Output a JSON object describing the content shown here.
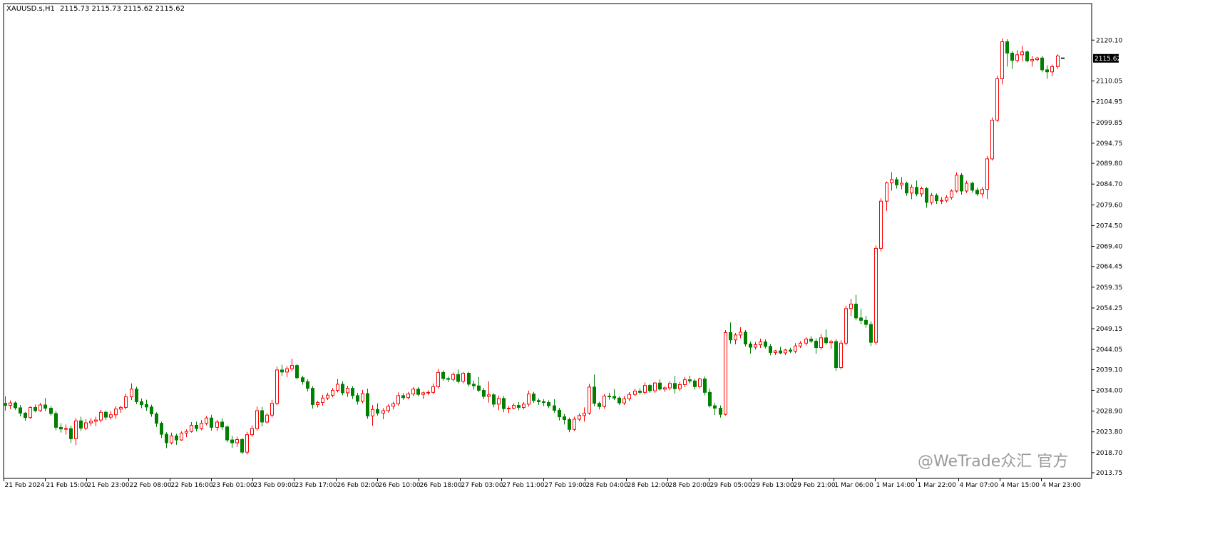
{
  "header": {
    "symbol": "XAUUSD.s,H1",
    "ohlc": "2115.73 2115.73 2115.62 2115.62"
  },
  "watermark": "@WeTrade众汇 官方",
  "colors": {
    "up": "#ff0000",
    "down": "#008000",
    "background": "#ffffff",
    "grid_frame": "#000000",
    "price_tag": "#000000"
  },
  "chart_data": {
    "type": "candlestick",
    "title": "",
    "symbol": "XAUUSD.s",
    "timeframe": "H1",
    "ylim": [
      2013.75,
      2124.0
    ],
    "y_ticks": [
      "2120.10",
      "2115.62",
      "2110.05",
      "2104.95",
      "2099.85",
      "2094.75",
      "2089.80",
      "2084.70",
      "2079.60",
      "2074.50",
      "2069.40",
      "2064.45",
      "2059.35",
      "2054.25",
      "2049.15",
      "2044.05",
      "2039.10",
      "2034.00",
      "2028.90",
      "2023.80",
      "2018.70",
      "2013.75"
    ],
    "x_ticks": [
      "21 Feb 2024",
      "21 Feb 15:00",
      "21 Feb 23:00",
      "22 Feb 08:00",
      "22 Feb 16:00",
      "23 Feb 01:00",
      "23 Feb 09:00",
      "23 Feb 17:00",
      "26 Feb 02:00",
      "26 Feb 10:00",
      "26 Feb 18:00",
      "27 Feb 03:00",
      "27 Feb 11:00",
      "27 Feb 19:00",
      "28 Feb 04:00",
      "28 Feb 12:00",
      "28 Feb 20:00",
      "29 Feb 05:00",
      "29 Feb 13:00",
      "29 Feb 21:00",
      "1 Mar 06:00",
      "1 Mar 14:00",
      "1 Mar 22:00",
      "4 Mar 07:00",
      "4 Mar 15:00",
      "4 Mar 23:00"
    ],
    "last_price": "2115.62",
    "grid": false,
    "candles_ohlc": [
      [
        2030.8,
        2032.5,
        2029.0,
        2030.3
      ],
      [
        2030.3,
        2031.5,
        2029.4,
        2030.9
      ],
      [
        2030.9,
        2031.3,
        2029.2,
        2029.7
      ],
      [
        2029.7,
        2030.4,
        2027.6,
        2028.4
      ],
      [
        2028.4,
        2028.7,
        2026.5,
        2027.3
      ],
      [
        2027.3,
        2030.1,
        2027.0,
        2029.8
      ],
      [
        2029.8,
        2030.5,
        2028.6,
        2029.0
      ],
      [
        2029.0,
        2030.9,
        2028.7,
        2030.4
      ],
      [
        2030.4,
        2032.1,
        2028.9,
        2029.6
      ],
      [
        2029.6,
        2030.2,
        2027.8,
        2028.3
      ],
      [
        2028.3,
        2028.9,
        2024.2,
        2024.9
      ],
      [
        2024.9,
        2025.9,
        2023.6,
        2024.5
      ],
      [
        2024.5,
        2025.6,
        2023.1,
        2024.6
      ],
      [
        2024.6,
        2025.3,
        2021.1,
        2022.1
      ],
      [
        2022.1,
        2027.2,
        2020.5,
        2026.5
      ],
      [
        2026.5,
        2027.5,
        2024.0,
        2024.7
      ],
      [
        2024.7,
        2026.9,
        2024.2,
        2026.0
      ],
      [
        2026.0,
        2027.2,
        2025.2,
        2026.4
      ],
      [
        2026.4,
        2027.5,
        2025.2,
        2026.7
      ],
      [
        2026.7,
        2029.2,
        2026.1,
        2028.6
      ],
      [
        2028.6,
        2029.0,
        2026.7,
        2027.4
      ],
      [
        2027.4,
        2028.9,
        2026.8,
        2028.0
      ],
      [
        2028.0,
        2030.1,
        2027.0,
        2029.4
      ],
      [
        2029.4,
        2030.2,
        2028.5,
        2029.8
      ],
      [
        2029.8,
        2033.2,
        2029.3,
        2032.4
      ],
      [
        2032.4,
        2035.7,
        2031.6,
        2034.3
      ],
      [
        2034.3,
        2034.9,
        2030.6,
        2031.2
      ],
      [
        2031.2,
        2032.0,
        2029.6,
        2030.5
      ],
      [
        2030.5,
        2031.7,
        2029.0,
        2029.9
      ],
      [
        2029.9,
        2030.5,
        2027.5,
        2028.2
      ],
      [
        2028.2,
        2028.6,
        2025.0,
        2025.9
      ],
      [
        2025.9,
        2026.3,
        2022.3,
        2023.2
      ],
      [
        2023.2,
        2023.7,
        2019.8,
        2021.1
      ],
      [
        2021.1,
        2023.6,
        2020.7,
        2022.8
      ],
      [
        2022.8,
        2023.3,
        2020.6,
        2021.8
      ],
      [
        2021.8,
        2023.9,
        2021.6,
        2023.5
      ],
      [
        2023.5,
        2024.4,
        2022.5,
        2023.9
      ],
      [
        2023.9,
        2026.2,
        2023.6,
        2025.4
      ],
      [
        2025.4,
        2026.3,
        2023.9,
        2024.6
      ],
      [
        2024.6,
        2026.7,
        2024.2,
        2025.9
      ],
      [
        2025.9,
        2027.7,
        2025.4,
        2027.2
      ],
      [
        2027.2,
        2028.0,
        2024.1,
        2024.9
      ],
      [
        2024.9,
        2026.7,
        2024.0,
        2026.2
      ],
      [
        2026.2,
        2027.1,
        2024.3,
        2025.0
      ],
      [
        2025.0,
        2025.4,
        2021.2,
        2021.8
      ],
      [
        2021.8,
        2022.8,
        2019.9,
        2021.1
      ],
      [
        2021.1,
        2022.6,
        2020.1,
        2021.9
      ],
      [
        2021.9,
        2022.3,
        2018.3,
        2018.8
      ],
      [
        2018.8,
        2023.8,
        2018.2,
        2023.1
      ],
      [
        2023.1,
        2025.4,
        2022.6,
        2024.6
      ],
      [
        2024.6,
        2030.0,
        2024.1,
        2029.0
      ],
      [
        2029.0,
        2029.9,
        2025.1,
        2026.2
      ],
      [
        2026.2,
        2028.4,
        2025.8,
        2027.9
      ],
      [
        2027.9,
        2031.7,
        2027.3,
        2030.8
      ],
      [
        2030.8,
        2039.8,
        2030.3,
        2039.0
      ],
      [
        2039.0,
        2040.3,
        2037.5,
        2038.5
      ],
      [
        2038.5,
        2040.0,
        2037.2,
        2039.3
      ],
      [
        2039.3,
        2041.8,
        2038.7,
        2040.1
      ],
      [
        2040.1,
        2040.5,
        2036.7,
        2037.1
      ],
      [
        2037.1,
        2037.6,
        2035.4,
        2036.1
      ],
      [
        2036.1,
        2036.7,
        2033.7,
        2034.5
      ],
      [
        2034.5,
        2035.0,
        2029.5,
        2030.5
      ],
      [
        2030.5,
        2031.4,
        2029.8,
        2031.0
      ],
      [
        2031.0,
        2032.9,
        2030.2,
        2032.1
      ],
      [
        2032.1,
        2033.4,
        2031.6,
        2032.8
      ],
      [
        2032.8,
        2034.6,
        2032.3,
        2034.0
      ],
      [
        2034.0,
        2036.8,
        2033.5,
        2035.5
      ],
      [
        2035.5,
        2036.2,
        2032.8,
        2033.4
      ],
      [
        2033.4,
        2035.1,
        2032.4,
        2034.5
      ],
      [
        2034.5,
        2035.0,
        2031.9,
        2032.7
      ],
      [
        2032.7,
        2033.4,
        2030.5,
        2031.3
      ],
      [
        2031.3,
        2034.1,
        2030.8,
        2033.2
      ],
      [
        2033.2,
        2034.4,
        2027.0,
        2027.7
      ],
      [
        2027.7,
        2030.4,
        2025.3,
        2029.3
      ],
      [
        2029.3,
        2030.8,
        2027.8,
        2028.4
      ],
      [
        2028.4,
        2029.6,
        2026.9,
        2029.0
      ],
      [
        2029.0,
        2030.6,
        2028.5,
        2030.1
      ],
      [
        2030.1,
        2031.2,
        2029.3,
        2030.7
      ],
      [
        2030.7,
        2033.5,
        2030.2,
        2032.7
      ],
      [
        2032.7,
        2033.3,
        2031.7,
        2032.2
      ],
      [
        2032.2,
        2033.6,
        2031.8,
        2033.1
      ],
      [
        2033.1,
        2034.8,
        2032.6,
        2034.3
      ],
      [
        2034.3,
        2034.8,
        2032.5,
        2033.0
      ],
      [
        2033.0,
        2033.7,
        2031.9,
        2033.4
      ],
      [
        2033.4,
        2034.0,
        2032.8,
        2033.5
      ],
      [
        2033.5,
        2035.7,
        2033.0,
        2034.9
      ],
      [
        2034.9,
        2039.3,
        2034.4,
        2038.4
      ],
      [
        2038.4,
        2038.9,
        2036.4,
        2036.9
      ],
      [
        2036.9,
        2037.4,
        2036.0,
        2036.7
      ],
      [
        2036.7,
        2038.4,
        2036.2,
        2037.9
      ],
      [
        2037.9,
        2039.1,
        2035.7,
        2036.2
      ],
      [
        2036.2,
        2038.5,
        2035.7,
        2038.2
      ],
      [
        2038.2,
        2038.6,
        2035.0,
        2035.5
      ],
      [
        2035.5,
        2036.4,
        2034.2,
        2035.1
      ],
      [
        2035.1,
        2037.3,
        2033.6,
        2034.0
      ],
      [
        2034.0,
        2034.6,
        2031.8,
        2032.5
      ],
      [
        2032.5,
        2036.2,
        2031.0,
        2032.9
      ],
      [
        2032.9,
        2033.3,
        2029.8,
        2030.6
      ],
      [
        2030.6,
        2032.7,
        2029.1,
        2032.0
      ],
      [
        2032.0,
        2032.6,
        2028.6,
        2029.5
      ],
      [
        2029.5,
        2030.1,
        2028.4,
        2029.6
      ],
      [
        2029.6,
        2030.8,
        2029.3,
        2030.3
      ],
      [
        2030.3,
        2031.1,
        2029.1,
        2029.8
      ],
      [
        2029.8,
        2031.1,
        2029.3,
        2030.6
      ],
      [
        2030.6,
        2033.9,
        2030.0,
        2033.1
      ],
      [
        2033.1,
        2033.6,
        2030.9,
        2031.5
      ],
      [
        2031.5,
        2032.0,
        2030.4,
        2031.2
      ],
      [
        2031.2,
        2031.8,
        2030.1,
        2031.0
      ],
      [
        2031.0,
        2031.5,
        2029.6,
        2030.2
      ],
      [
        2030.2,
        2031.8,
        2028.5,
        2029.1
      ],
      [
        2029.1,
        2029.7,
        2026.6,
        2027.5
      ],
      [
        2027.5,
        2028.2,
        2025.6,
        2026.8
      ],
      [
        2026.8,
        2027.3,
        2023.7,
        2024.4
      ],
      [
        2024.4,
        2027.5,
        2024.0,
        2026.9
      ],
      [
        2026.9,
        2028.3,
        2026.4,
        2027.8
      ],
      [
        2027.8,
        2029.8,
        2026.3,
        2028.4
      ],
      [
        2028.4,
        2035.6,
        2028.0,
        2034.8
      ],
      [
        2034.8,
        2037.9,
        2030.1,
        2030.8
      ],
      [
        2030.8,
        2031.2,
        2029.3,
        2030.0
      ],
      [
        2030.0,
        2033.1,
        2029.5,
        2032.6
      ],
      [
        2032.6,
        2033.4,
        2031.7,
        2032.5
      ],
      [
        2032.5,
        2034.3,
        2031.6,
        2032.1
      ],
      [
        2032.1,
        2032.5,
        2030.4,
        2030.9
      ],
      [
        2030.9,
        2032.6,
        2030.4,
        2031.9
      ],
      [
        2031.9,
        2033.6,
        2031.4,
        2033.0
      ],
      [
        2033.0,
        2034.4,
        2032.5,
        2033.8
      ],
      [
        2033.8,
        2034.5,
        2033.0,
        2033.5
      ],
      [
        2033.5,
        2035.9,
        2033.0,
        2035.2
      ],
      [
        2035.2,
        2035.6,
        2033.4,
        2033.9
      ],
      [
        2033.9,
        2036.0,
        2033.4,
        2035.8
      ],
      [
        2035.8,
        2036.7,
        2033.9,
        2034.3
      ],
      [
        2034.3,
        2035.0,
        2033.6,
        2034.6
      ],
      [
        2034.6,
        2036.2,
        2034.0,
        2035.7
      ],
      [
        2035.7,
        2037.5,
        2033.2,
        2034.4
      ],
      [
        2034.4,
        2036.1,
        2033.8,
        2035.4
      ],
      [
        2035.4,
        2037.3,
        2034.8,
        2036.6
      ],
      [
        2036.6,
        2037.6,
        2035.7,
        2036.3
      ],
      [
        2036.3,
        2036.8,
        2034.2,
        2034.9
      ],
      [
        2034.9,
        2037.1,
        2034.5,
        2036.8
      ],
      [
        2036.8,
        2037.4,
        2032.8,
        2033.5
      ],
      [
        2033.5,
        2034.4,
        2029.8,
        2030.2
      ],
      [
        2030.2,
        2030.9,
        2027.9,
        2029.6
      ],
      [
        2029.6,
        2030.3,
        2027.3,
        2028.1
      ],
      [
        2028.1,
        2048.8,
        2027.8,
        2048.2
      ],
      [
        2048.2,
        2050.7,
        2045.5,
        2046.4
      ],
      [
        2046.4,
        2048.1,
        2045.3,
        2047.6
      ],
      [
        2047.6,
        2049.5,
        2046.8,
        2048.3
      ],
      [
        2048.3,
        2048.8,
        2044.8,
        2045.4
      ],
      [
        2045.4,
        2046.0,
        2043.0,
        2044.6
      ],
      [
        2044.6,
        2045.9,
        2044.0,
        2045.2
      ],
      [
        2045.2,
        2046.7,
        2044.4,
        2045.9
      ],
      [
        2045.9,
        2046.5,
        2044.3,
        2044.8
      ],
      [
        2044.8,
        2045.4,
        2042.6,
        2043.3
      ],
      [
        2043.3,
        2043.9,
        2042.7,
        2043.7
      ],
      [
        2043.7,
        2044.7,
        2042.9,
        2043.2
      ],
      [
        2043.2,
        2044.2,
        2042.7,
        2043.9
      ],
      [
        2043.9,
        2044.5,
        2043.1,
        2043.6
      ],
      [
        2043.6,
        2045.6,
        2043.1,
        2044.9
      ],
      [
        2044.9,
        2046.1,
        2044.4,
        2045.6
      ],
      [
        2045.6,
        2047.1,
        2045.0,
        2046.6
      ],
      [
        2046.6,
        2047.3,
        2045.6,
        2046.1
      ],
      [
        2046.1,
        2046.8,
        2043.0,
        2044.5
      ],
      [
        2044.5,
        2047.8,
        2044.0,
        2046.9
      ],
      [
        2046.9,
        2049.0,
        2045.2,
        2045.7
      ],
      [
        2045.7,
        2046.4,
        2044.2,
        2046.0
      ],
      [
        2046.0,
        2046.6,
        2038.8,
        2039.6
      ],
      [
        2039.6,
        2046.3,
        2039.1,
        2045.6
      ],
      [
        2045.6,
        2054.8,
        2045.1,
        2054.1
      ],
      [
        2054.1,
        2056.5,
        2052.3,
        2055.2
      ],
      [
        2055.2,
        2057.5,
        2051.2,
        2051.8
      ],
      [
        2051.8,
        2054.0,
        2050.3,
        2051.2
      ],
      [
        2051.2,
        2052.3,
        2049.4,
        2050.2
      ],
      [
        2050.2,
        2051.0,
        2044.9,
        2045.8
      ],
      [
        2045.8,
        2069.6,
        2045.2,
        2068.9
      ],
      [
        2068.9,
        2081.2,
        2068.2,
        2080.5
      ],
      [
        2080.5,
        2085.3,
        2078.1,
        2085.0
      ],
      [
        2085.0,
        2087.6,
        2083.1,
        2085.8
      ],
      [
        2085.8,
        2086.5,
        2083.6,
        2084.5
      ],
      [
        2084.5,
        2086.4,
        2083.4,
        2084.9
      ],
      [
        2084.9,
        2085.3,
        2081.8,
        2082.5
      ],
      [
        2082.5,
        2084.6,
        2081.0,
        2083.9
      ],
      [
        2083.9,
        2085.6,
        2081.7,
        2082.3
      ],
      [
        2082.3,
        2084.1,
        2081.6,
        2083.6
      ],
      [
        2083.6,
        2084.0,
        2078.9,
        2080.2
      ],
      [
        2080.2,
        2082.5,
        2079.6,
        2081.9
      ],
      [
        2081.9,
        2082.4,
        2079.8,
        2080.6
      ],
      [
        2080.6,
        2081.5,
        2079.8,
        2080.7
      ],
      [
        2080.7,
        2082.0,
        2080.2,
        2081.4
      ],
      [
        2081.4,
        2083.4,
        2080.9,
        2083.0
      ],
      [
        2083.0,
        2087.6,
        2082.6,
        2086.9
      ],
      [
        2086.9,
        2087.4,
        2082.1,
        2083.0
      ],
      [
        2083.0,
        2085.5,
        2082.5,
        2084.9
      ],
      [
        2084.9,
        2085.3,
        2082.6,
        2083.2
      ],
      [
        2083.2,
        2083.8,
        2081.8,
        2082.3
      ],
      [
        2082.3,
        2084.0,
        2081.4,
        2083.4
      ],
      [
        2083.4,
        2091.6,
        2081.0,
        2090.9
      ],
      [
        2090.9,
        2101.1,
        2090.5,
        2100.4
      ],
      [
        2100.4,
        2111.3,
        2100.0,
        2110.6
      ],
      [
        2110.6,
        2120.5,
        2109.2,
        2119.7
      ],
      [
        2119.7,
        2120.3,
        2113.6,
        2116.9
      ],
      [
        2116.9,
        2117.4,
        2113.0,
        2115.1
      ],
      [
        2115.1,
        2117.6,
        2114.6,
        2116.5
      ],
      [
        2116.5,
        2118.7,
        2114.9,
        2117.2
      ],
      [
        2117.2,
        2117.6,
        2114.6,
        2115.0
      ],
      [
        2115.0,
        2116.2,
        2113.6,
        2115.3
      ],
      [
        2115.3,
        2116.0,
        2114.9,
        2115.7
      ],
      [
        2115.7,
        2116.2,
        2112.2,
        2112.8
      ],
      [
        2112.8,
        2113.9,
        2110.6,
        2112.3
      ],
      [
        2112.3,
        2114.1,
        2111.2,
        2113.6
      ],
      [
        2113.6,
        2116.6,
        2113.1,
        2116.2
      ],
      [
        2115.73,
        2115.73,
        2115.62,
        2115.62
      ]
    ]
  }
}
